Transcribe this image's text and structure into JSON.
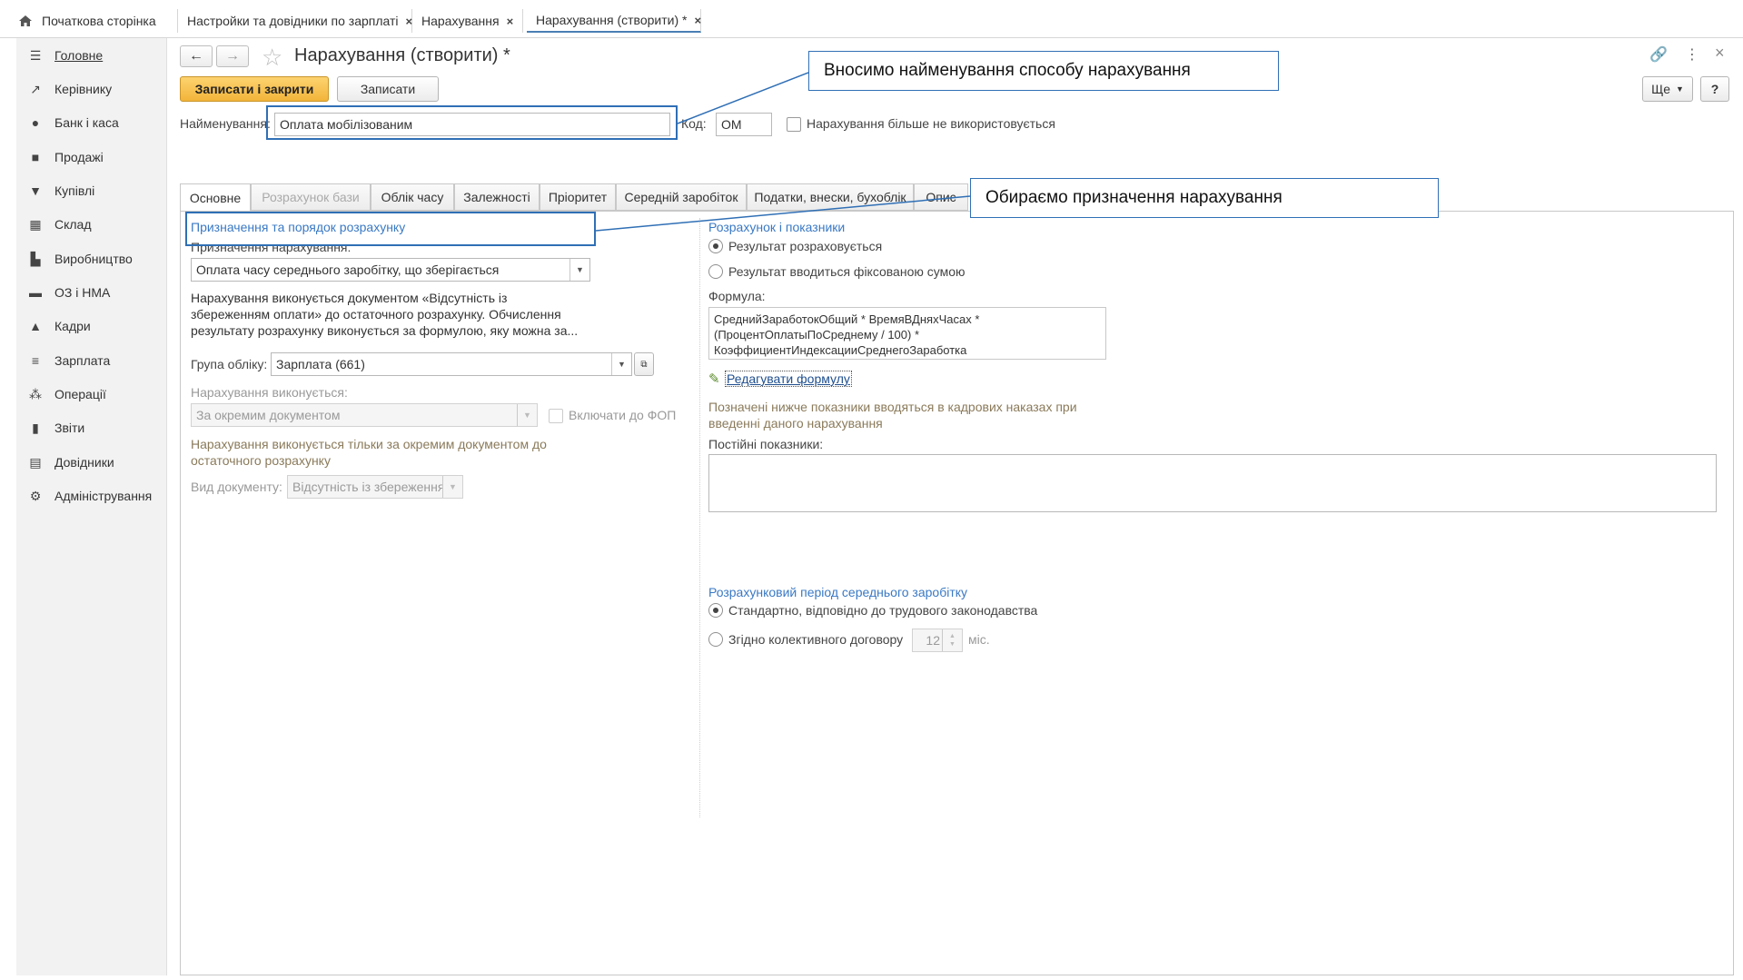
{
  "top_tabs": [
    {
      "label": "Початкова сторінка",
      "closable": false
    },
    {
      "label": "Настройки та довідники по зарплаті",
      "closable": true
    },
    {
      "label": "Нарахування",
      "closable": true
    },
    {
      "label": "Нарахування (створити) *",
      "closable": true,
      "active": true
    }
  ],
  "close_glyph": "×",
  "sidebar": {
    "items": [
      {
        "label": "Головне",
        "icon": "menu-icon"
      },
      {
        "label": "Керівнику",
        "icon": "chart-icon"
      },
      {
        "label": "Банк і каса",
        "icon": "bank-icon"
      },
      {
        "label": "Продажі",
        "icon": "sales-icon"
      },
      {
        "label": "Купівлі",
        "icon": "cart-icon"
      },
      {
        "label": "Склад",
        "icon": "warehouse-icon"
      },
      {
        "label": "Виробництво",
        "icon": "factory-icon"
      },
      {
        "label": "ОЗ і НМА",
        "icon": "truck-icon"
      },
      {
        "label": "Кадри",
        "icon": "person-icon"
      },
      {
        "label": "Зарплата",
        "icon": "payroll-icon"
      },
      {
        "label": "Операції",
        "icon": "operations-icon"
      },
      {
        "label": "Звіти",
        "icon": "reports-icon"
      },
      {
        "label": "Довідники",
        "icon": "books-icon"
      },
      {
        "label": "Адміністрування",
        "icon": "gear-icon"
      }
    ]
  },
  "header": {
    "title": "Нарахування (створити) *",
    "more_label": "Ще",
    "help_label": "?"
  },
  "toolbar": {
    "save_close_label": "Записати і закрити",
    "save_label": "Записати"
  },
  "form": {
    "name_label": "Найменування:",
    "name_value": "Оплата мобілізованим",
    "code_label": "Код:",
    "code_value": "ОМ",
    "not_used_label": "Нарахування більше не використовується"
  },
  "form_tabs": [
    {
      "label": "Основне",
      "active": true
    },
    {
      "label": "Розрахунок бази",
      "disabled": true
    },
    {
      "label": "Облік часу"
    },
    {
      "label": "Залежності"
    },
    {
      "label": "Пріоритет"
    },
    {
      "label": "Середній заробіток"
    },
    {
      "label": "Податки, внески, бухоблік"
    },
    {
      "label": "Опис"
    }
  ],
  "left": {
    "section_title": "Призначення та порядок розрахунку",
    "purpose_label": "Призначення нарахування:",
    "purpose_value": "Оплата часу середнього заробітку, що зберігається",
    "description": "Нарахування виконується документом «Відсутність із збереженням оплати» до остаточного розрахунку. Обчислення результату розрахунку виконується за формулою, яку можна за...",
    "group_label": "Група обліку:",
    "group_value": "Зарплата (661)",
    "executed_label": "Нарахування виконується:",
    "executed_value": "За окремим документом",
    "fop_label": "Включати до ФОП",
    "separate_doc_note": "Нарахування виконується тільки за окремим документом до остаточного розрахунку",
    "doc_type_label": "Вид документу:",
    "doc_type_value": "Відсутність із збереження"
  },
  "right": {
    "section_title": "Розрахунок і показники",
    "radio_calculated": "Результат розраховується",
    "radio_fixed": "Результат вводиться фіксованою сумою",
    "formula_label": "Формула:",
    "formula_text": "СреднийЗаработокОбщий * ВремяВДняхЧасах * (ПроцентОплатыПоСреднему / 100) * КоэффициентИндексацииСреднегоЗаработка",
    "edit_formula_link": "Редагувати формулу",
    "indicators_note": "Позначені нижче показники вводяться в кадрових наказах при введенні даного нарахування",
    "constant_label": "Постійні показники:",
    "period_title": "Розрахунковий період середнього заробітку",
    "radio_standard": "Стандартно, відповідно до трудового законодавства",
    "radio_collective": "Згідно колективного договору",
    "months_value": "12",
    "months_unit": "міс."
  },
  "callouts": {
    "name_hint": "Вносимо найменування способу нарахування",
    "purpose_hint": "Обираємо призначення нарахування"
  },
  "colors": {
    "accent": "#2f6fb5",
    "primary_button": "#f2b43a",
    "section_title": "#3a79c4"
  }
}
